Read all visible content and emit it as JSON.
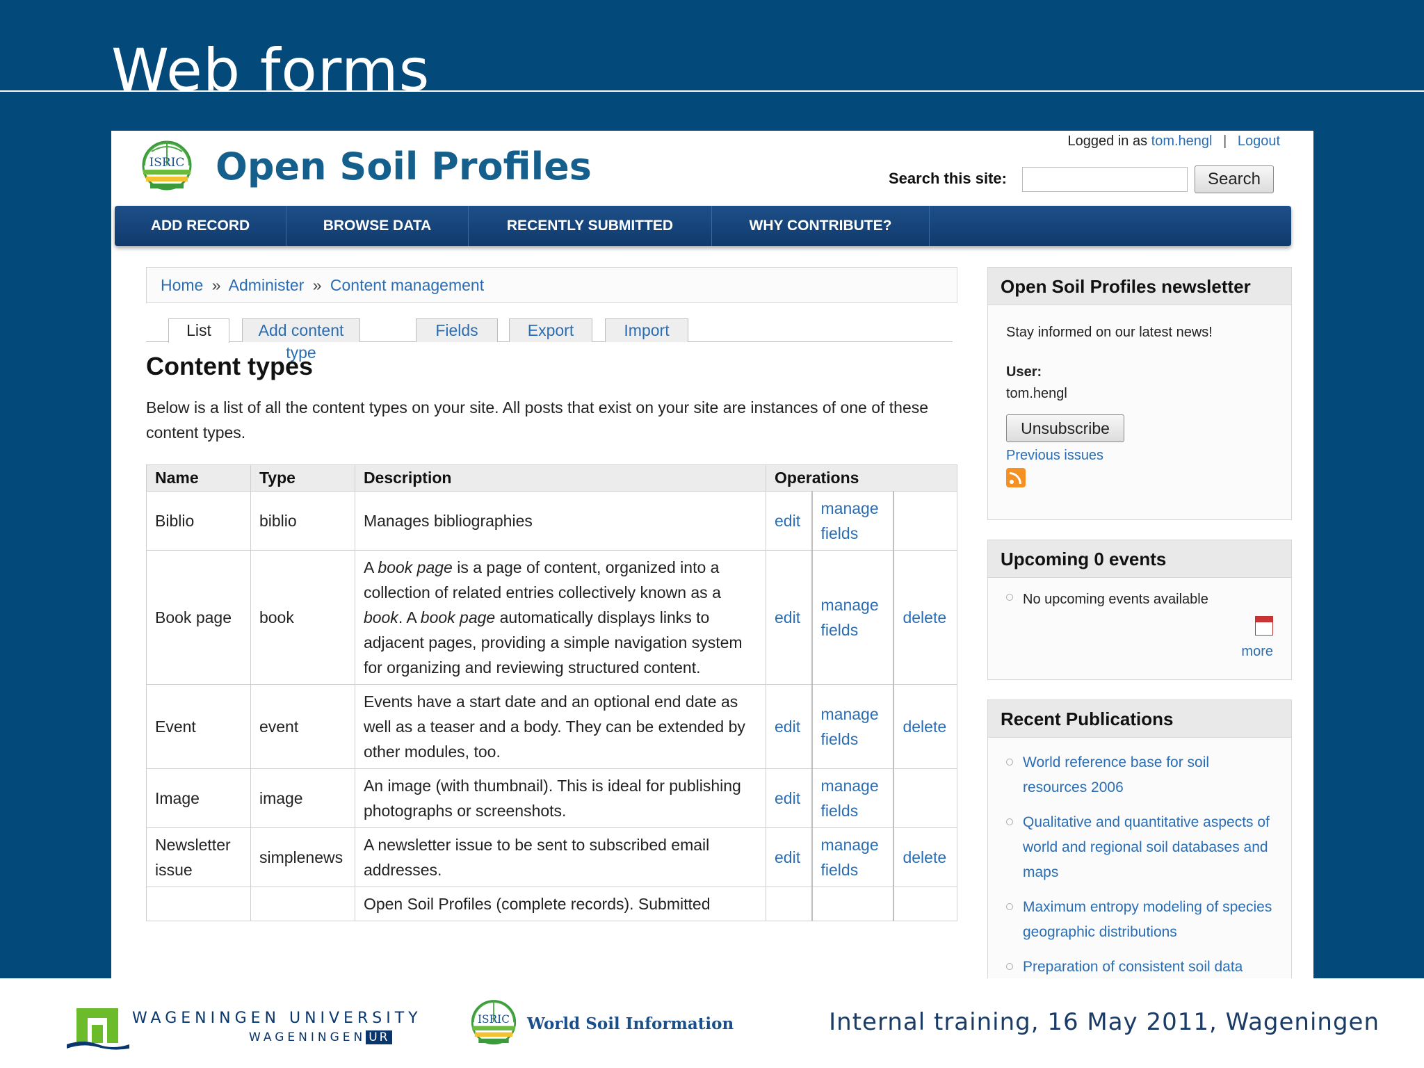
{
  "slide": {
    "title": "Web forms",
    "footer": {
      "wur_line1": "WAGENINGEN UNIVERSITY",
      "wur_line2_a": "WAGENINGEN",
      "wur_line2_b": "UR",
      "isric_text": "World Soil Information",
      "caption": "Internal training, 16 May 2011, Wageningen"
    }
  },
  "site": {
    "name": "Open Soil Profiles",
    "logo_text": "ISRIC",
    "login": {
      "prefix": "Logged in as",
      "user": "tom.hengl",
      "sep": "|",
      "logout": "Logout"
    },
    "search": {
      "label": "Search this site:",
      "value": "",
      "button": "Search"
    },
    "nav": [
      {
        "label": "ADD RECORD"
      },
      {
        "label": "BROWSE DATA"
      },
      {
        "label": "RECENTLY SUBMITTED"
      },
      {
        "label": "WHY CONTRIBUTE?"
      }
    ],
    "breadcrumb": {
      "items": [
        "Home",
        "Administer",
        "Content management"
      ],
      "sep": "»"
    },
    "tabs": [
      {
        "label": "List",
        "active": true
      },
      {
        "label": "Add content type"
      },
      {
        "label": "Fields"
      },
      {
        "label": "Export"
      },
      {
        "label": "Import"
      }
    ],
    "heading": "Content types",
    "intro": "Below is a list of all the content types on your site. All posts that exist on your site are instances of one of these content types.",
    "table": {
      "headers": [
        "Name",
        "Type",
        "Description",
        "Operations"
      ],
      "rows": [
        {
          "name": "Biblio",
          "type": "biblio",
          "description": "Manages bibliographies",
          "edit": "edit",
          "manage": "manage fields",
          "delete": ""
        },
        {
          "name": "Book page",
          "type": "book",
          "description_parts": [
            "A ",
            "book page",
            " is a page of content, organized into a collection of related entries collectively known as a ",
            "book",
            ". A ",
            "book page",
            " automatically displays links to adjacent pages, providing a simple navigation system for organizing and reviewing structured content."
          ],
          "edit": "edit",
          "manage": "manage fields",
          "delete": "delete"
        },
        {
          "name": "Event",
          "type": "event",
          "description": "Events have a start date and an optional end date as well as a teaser and a body. They can be extended by other modules, too.",
          "edit": "edit",
          "manage": "manage fields",
          "delete": "delete"
        },
        {
          "name": "Image",
          "type": "image",
          "description": "An image (with thumbnail). This is ideal for publishing photographs or screenshots.",
          "edit": "edit",
          "manage": "manage fields",
          "delete": ""
        },
        {
          "name": "Newsletter issue",
          "type": "simplenews",
          "description": "A newsletter issue to be sent to subscribed email addresses.",
          "edit": "edit",
          "manage": "manage fields",
          "delete": "delete"
        },
        {
          "name": "",
          "type": "",
          "description": "Open Soil Profiles (complete records). Submitted",
          "edit": "",
          "manage": "",
          "delete": ""
        }
      ]
    },
    "sidebar": {
      "newsletter": {
        "title": "Open Soil Profiles newsletter",
        "text": "Stay informed on our latest news!",
        "user_label": "User:",
        "user": "tom.hengl",
        "button": "Unsubscribe",
        "previous": "Previous issues",
        "icon": "rss-icon"
      },
      "events": {
        "title": "Upcoming 0 events",
        "item": "No upcoming events available",
        "more": "more",
        "icon": "calendar-icon"
      },
      "publications": {
        "title": "Recent Publications",
        "items": [
          "World reference base for soil resources 2006",
          "Qualitative and quantitative aspects of world and regional soil databases and maps",
          "Maximum entropy modeling of species geographic distributions",
          "Preparation of consistent soil data sets for SOC modelling purposes:"
        ]
      }
    }
  },
  "colors": {
    "slide_bg": "#03497a",
    "brand_blue": "#155f8c",
    "link": "#2a6db2",
    "nav_bg": "#1e4f88"
  }
}
